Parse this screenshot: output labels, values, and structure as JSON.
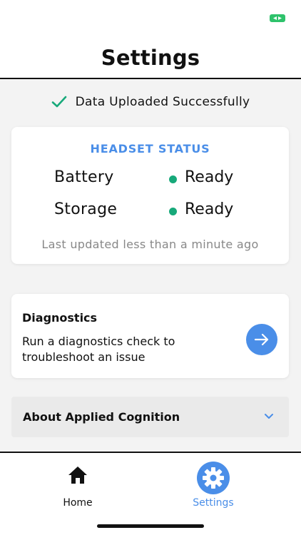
{
  "header": {
    "title": "Settings"
  },
  "upload_status": {
    "text": "Data Uploaded Successfully"
  },
  "headset_status": {
    "title": "HEADSET STATUS",
    "rows": [
      {
        "label": "Battery",
        "value": "Ready"
      },
      {
        "label": "Storage",
        "value": "Ready"
      }
    ],
    "last_updated": "Last updated less than a minute ago"
  },
  "diagnostics": {
    "title": "Diagnostics",
    "description": "Run a diagnostics check to troubleshoot an issue"
  },
  "about": {
    "label": "About Applied Cognition"
  },
  "tabs": [
    {
      "label": "Home",
      "icon": "home-icon",
      "active": false
    },
    {
      "label": "Settings",
      "icon": "gear-icon",
      "active": true
    }
  ],
  "colors": {
    "accent": "#4a8ee8",
    "status_ok": "#17a97a",
    "check": "#17a97a",
    "battery": "#2ec26b"
  }
}
